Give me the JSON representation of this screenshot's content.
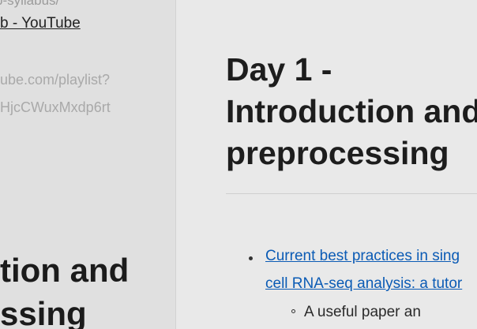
{
  "left": {
    "cut_text": "p-syllabus/",
    "link_text": "b - YouTube",
    "url_line1": "ube.com/playlist?",
    "url_line2": "HjcCWuxMxdp6rt",
    "heading_line1": "tion and",
    "heading_line2": "ssing"
  },
  "right": {
    "title": "Day 1 - Introduction and preprocessing",
    "link_line1": "Current best practices in sing",
    "link_line2": "cell RNA-seq analysis: a tutor",
    "sub_item": "A useful paper an"
  }
}
